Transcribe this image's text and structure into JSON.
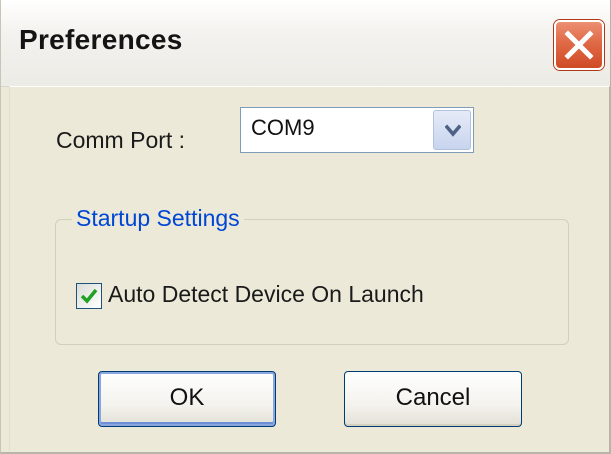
{
  "window": {
    "title": "Preferences",
    "close_icon": "close-icon"
  },
  "comm_port": {
    "label": "Comm Port :",
    "selected": "COM9",
    "dropdown_icon": "chevron-down-icon"
  },
  "startup_settings": {
    "legend": "Startup Settings",
    "auto_detect": {
      "label": "Auto Detect Device On Launch",
      "checked": true,
      "check_icon": "checkmark-icon"
    }
  },
  "buttons": {
    "ok": "OK",
    "cancel": "Cancel"
  },
  "colors": {
    "accent_legend": "#0046d5",
    "close_button": "#e06a46",
    "checkmark": "#21a121"
  }
}
